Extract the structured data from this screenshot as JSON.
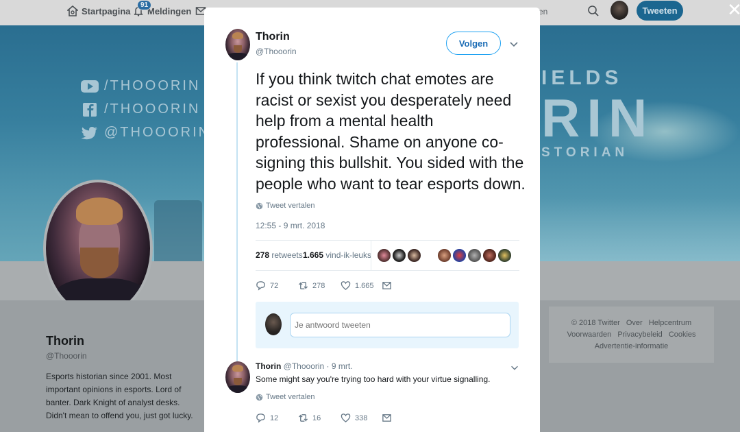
{
  "topbar": {
    "home_label": "Startpagina",
    "notifications_label": "Meldingen",
    "notifications_count": "91",
    "search_placeholder_fragment": "en",
    "tweet_button": "Tweeten",
    "close_symbol": "✕"
  },
  "banner": {
    "youtube_handle": "/THOOORIN",
    "facebook_handle": "/THOOORIN",
    "twitter_handle": "@THOOORIN",
    "word_top": "IELDS",
    "word_big": "RIN",
    "word_bottom": "STORIAN"
  },
  "profile": {
    "name": "Thorin",
    "handle": "@Thooorin",
    "bio": "Esports historian since 2001. Most important opinions in esports. Lord of banter. Dark Knight of analyst desks. Didn't mean to offend you, just got lucky."
  },
  "footer": {
    "links_row1": [
      "© 2018 Twitter",
      "Over",
      "Helpcentrum"
    ],
    "links_row2": [
      "Voorwaarden",
      "Privacybeleid",
      "Cookies"
    ],
    "links_row3": [
      "Advertentie-informatie"
    ]
  },
  "tweet": {
    "author_name": "Thorin",
    "author_handle": "@Thooorin",
    "follow_label": "Volgen",
    "text": "If you think twitch chat emotes are racist or sexist you desperately need help from a mental health professional. Shame on anyone co-signing this bullshit. You sided with the people who want to tear esports down.",
    "translate_label": "Tweet vertalen",
    "timestamp": "12:55 - 9 mrt. 2018",
    "retweets_count": "278",
    "retweets_label": "retweets",
    "likes_count": "1.665",
    "likes_label": "vind-ik-leuks",
    "actions": {
      "replies": "72",
      "retweets": "278",
      "likes": "1.665"
    },
    "reply_placeholder": "Je antwoord tweeten"
  },
  "reply": {
    "author_name": "Thorin",
    "meta": "@Thooorin · 9 mrt.",
    "text": "Some might say you're trying too hard with your virtue signalling.",
    "translate_label": "Tweet vertalen",
    "actions": {
      "replies": "12",
      "retweets": "16",
      "likes": "338"
    }
  },
  "colors": {
    "accent": "#1da1f2",
    "action_gray": "#657786",
    "reply_box_bg": "#e8f5fd",
    "thread_line": "#c4e3f3"
  },
  "icons": [
    "home-icon",
    "bell-icon",
    "mail-icon",
    "search-icon",
    "close-icon",
    "youtube-icon",
    "facebook-icon",
    "twitter-bird-icon",
    "chevron-down-icon",
    "globe-icon",
    "reply-icon",
    "retweet-icon",
    "heart-icon",
    "direct-message-icon"
  ]
}
